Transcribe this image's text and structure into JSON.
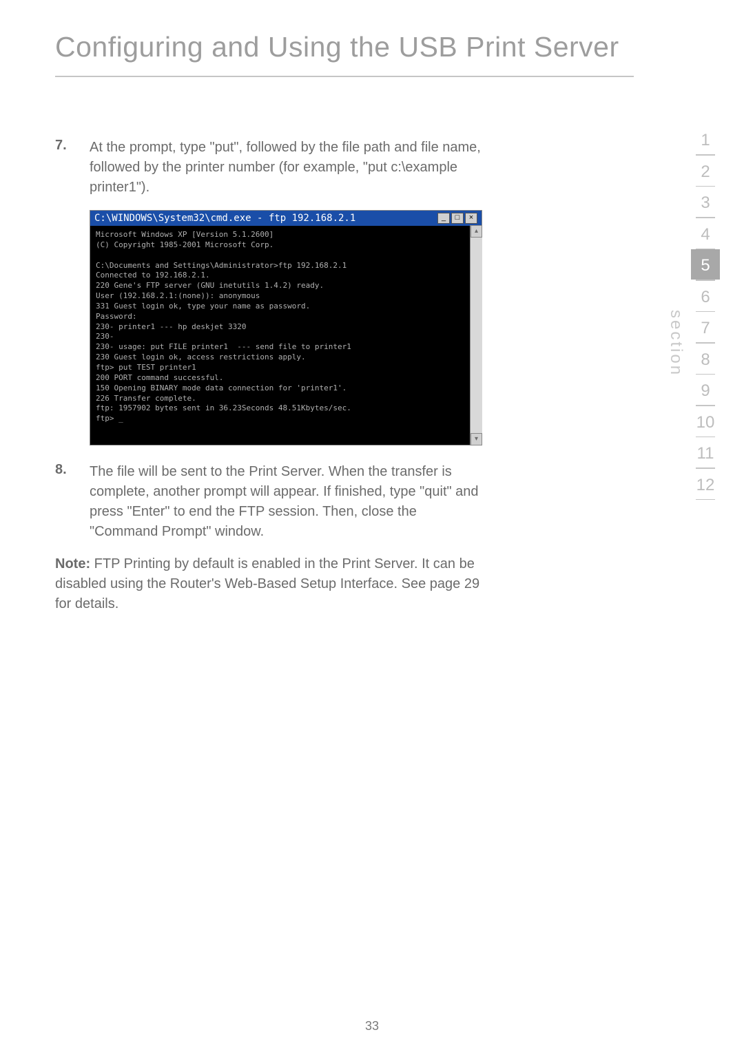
{
  "title": "Configuring and Using the USB Print Server",
  "steps": [
    {
      "num": "7.",
      "text": "At the prompt, type \"put\", followed by the file path and file name, followed by the printer number (for example, \"put c:\\example printer1\")."
    },
    {
      "num": "8.",
      "text": "The file will be sent to the Print Server. When the transfer is complete, another prompt will appear. If finished, type \"quit\" and press \"Enter\" to end the FTP session. Then, close the \"Command Prompt\" window."
    }
  ],
  "screenshot": {
    "titlebar": "C:\\WINDOWS\\System32\\cmd.exe - ftp 192.168.2.1",
    "body": "Microsoft Windows XP [Version 5.1.2600]\n(C) Copyright 1985-2001 Microsoft Corp.\n\nC:\\Documents and Settings\\Administrator>ftp 192.168.2.1\nConnected to 192.168.2.1.\n220 Gene's FTP server (GNU inetutils 1.4.2) ready.\nUser (192.168.2.1:(none)): anonymous\n331 Guest login ok, type your name as password.\nPassword:\n230- printer1 --- hp deskjet 3320\n230-\n230- usage: put FILE printer1  --- send file to printer1\n230 Guest login ok, access restrictions apply.\nftp> put TEST printer1\n200 PORT command successful.\n150 Opening BINARY mode data connection for 'printer1'.\n226 Transfer complete.\nftp: 1957902 bytes sent in 36.23Seconds 48.51Kbytes/sec.\nftp> _"
  },
  "note": {
    "label": "Note:",
    "text": " FTP Printing by default is enabled in the Print Server. It can be disabled using the Router's Web-Based Setup Interface. See page 29 for details."
  },
  "sectionLabel": "section",
  "sectionNav": [
    "1",
    "2",
    "3",
    "4",
    "5",
    "6",
    "7",
    "8",
    "9",
    "10",
    "11",
    "12"
  ],
  "activeSection": "5",
  "pageNumber": "33",
  "windowBtns": {
    "min": "_",
    "max": "□",
    "close": "×"
  },
  "scroll": {
    "up": "▴",
    "down": "▾"
  }
}
